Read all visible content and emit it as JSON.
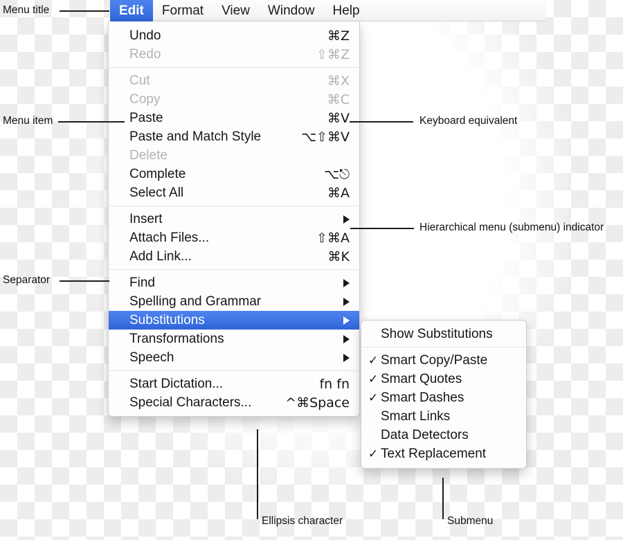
{
  "menubar": {
    "items": [
      {
        "label": "Edit",
        "selected": true
      },
      {
        "label": "Format",
        "selected": false
      },
      {
        "label": "View",
        "selected": false
      },
      {
        "label": "Window",
        "selected": false
      },
      {
        "label": "Help",
        "selected": false
      }
    ]
  },
  "menu": {
    "groups": [
      {
        "items": [
          {
            "label": "Undo",
            "key": "⌘Z",
            "disabled": false,
            "submenu": false
          },
          {
            "label": "Redo",
            "key": "⇧⌘Z",
            "disabled": true,
            "submenu": false
          }
        ]
      },
      {
        "items": [
          {
            "label": "Cut",
            "key": "⌘X",
            "disabled": true,
            "submenu": false
          },
          {
            "label": "Copy",
            "key": "⌘C",
            "disabled": true,
            "submenu": false
          },
          {
            "label": "Paste",
            "key": "⌘V",
            "disabled": false,
            "submenu": false
          },
          {
            "label": "Paste and Match Style",
            "key": "⌥⇧⌘V",
            "disabled": false,
            "submenu": false
          },
          {
            "label": "Delete",
            "key": "",
            "disabled": true,
            "submenu": false
          },
          {
            "label": "Complete",
            "key": "⌥⎋",
            "disabled": false,
            "submenu": false
          },
          {
            "label": "Select All",
            "key": "⌘A",
            "disabled": false,
            "submenu": false
          }
        ]
      },
      {
        "items": [
          {
            "label": "Insert",
            "key": "",
            "disabled": false,
            "submenu": true
          },
          {
            "label": "Attach Files...",
            "key": "⇧⌘A",
            "disabled": false,
            "submenu": false
          },
          {
            "label": "Add Link...",
            "key": "⌘K",
            "disabled": false,
            "submenu": false
          }
        ]
      },
      {
        "items": [
          {
            "label": "Find",
            "key": "",
            "disabled": false,
            "submenu": true
          },
          {
            "label": "Spelling and Grammar",
            "key": "",
            "disabled": false,
            "submenu": true
          },
          {
            "label": "Substitutions",
            "key": "",
            "disabled": false,
            "submenu": true,
            "selected": true
          },
          {
            "label": "Transformations",
            "key": "",
            "disabled": false,
            "submenu": true
          },
          {
            "label": "Speech",
            "key": "",
            "disabled": false,
            "submenu": true
          }
        ]
      },
      {
        "items": [
          {
            "label": "Start Dictation...",
            "key": "fn fn",
            "disabled": false,
            "submenu": false
          },
          {
            "label": "Special Characters...",
            "key": "^⌘Space",
            "disabled": false,
            "submenu": false
          }
        ]
      }
    ]
  },
  "submenu": {
    "groups": [
      {
        "items": [
          {
            "label": "Show Substitutions",
            "checked": false
          }
        ]
      },
      {
        "items": [
          {
            "label": "Smart Copy/Paste",
            "checked": true
          },
          {
            "label": "Smart Quotes",
            "checked": true
          },
          {
            "label": "Smart Dashes",
            "checked": true
          },
          {
            "label": "Smart Links",
            "checked": false
          },
          {
            "label": "Data Detectors",
            "checked": false
          },
          {
            "label": "Text Replacement",
            "checked": true
          }
        ]
      }
    ],
    "check_glyph": "✓"
  },
  "annotations": {
    "menu_title": "Menu title",
    "menu_item": "Menu item",
    "separator": "Separator",
    "keyboard_equivalent": "Keyboard equivalent",
    "hierarchical": "Hierarchical menu (submenu) indicator",
    "ellipsis": "Ellipsis character",
    "submenu": "Submenu"
  },
  "colors": {
    "highlight_blue_top": "#4f84ee",
    "highlight_blue_bottom": "#2f64da",
    "menu_bg": "#fdfdfd",
    "disabled_text": "#b2b2b2",
    "separator": "#e2e2e2"
  }
}
